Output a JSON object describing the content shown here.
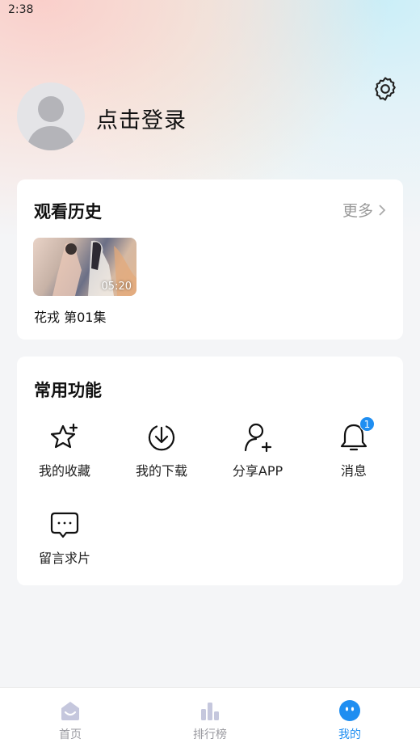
{
  "status_bar": {
    "time": "2:38"
  },
  "profile": {
    "login_text": "点击登录"
  },
  "history": {
    "title": "观看历史",
    "more_label": "更多",
    "items": [
      {
        "title": "花戎 第01集",
        "duration": "05:20"
      }
    ]
  },
  "functions": {
    "title": "常用功能",
    "items": [
      {
        "label": "我的收藏",
        "icon": "star-icon"
      },
      {
        "label": "我的下载",
        "icon": "download-icon"
      },
      {
        "label": "分享APP",
        "icon": "share-user-icon"
      },
      {
        "label": "消息",
        "icon": "bell-icon",
        "badge": "1"
      },
      {
        "label": "留言求片",
        "icon": "message-icon"
      }
    ]
  },
  "tabs": [
    {
      "label": "首页",
      "icon": "home-icon"
    },
    {
      "label": "排行榜",
      "icon": "ranking-icon"
    },
    {
      "label": "我的",
      "icon": "mine-icon",
      "active": true
    }
  ],
  "colors": {
    "accent": "#1f8ef1",
    "inactive_tab": "#9a9aa0",
    "page_bg": "#f4f5f7"
  }
}
